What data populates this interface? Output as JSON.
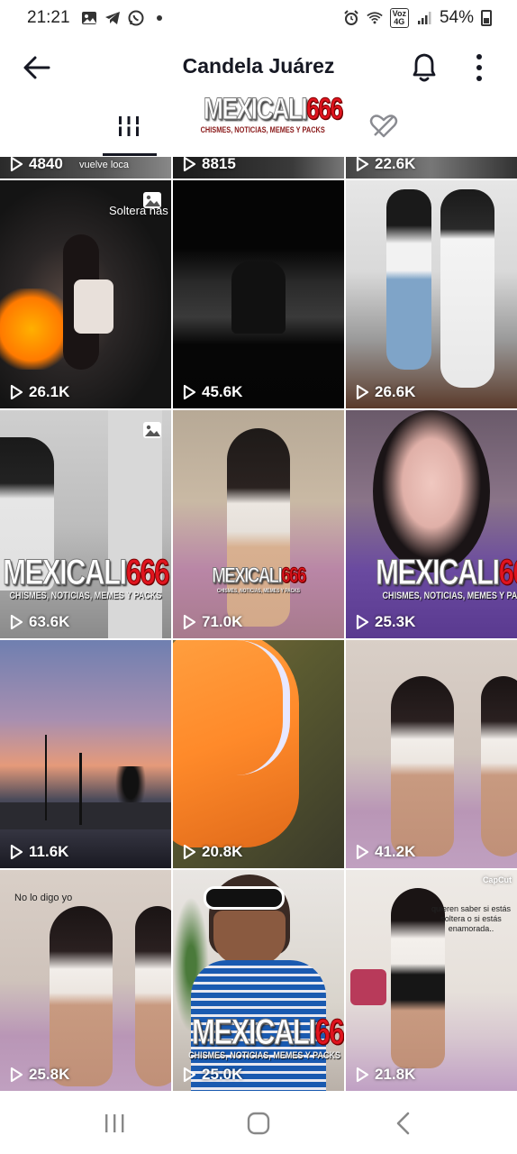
{
  "status_bar": {
    "time": "21:21",
    "notification_icons": [
      "gallery-icon",
      "telegram-icon",
      "whatsapp-icon"
    ],
    "network_badge_top": "Voz",
    "network_badge_bottom": "4G",
    "battery": "54%"
  },
  "header": {
    "title": "Candela Juárez"
  },
  "watermark": {
    "main": "MEXICALI",
    "number": "666",
    "subtitle": "CHISMES, NOTICIAS, MEMES Y PACKS"
  },
  "tabs": [
    {
      "name": "videos",
      "icon": "grid-lines-icon",
      "active": true
    },
    {
      "name": "liked",
      "icon": "hidden-heart-icon",
      "active": false
    }
  ],
  "videos": [
    {
      "views": "4840",
      "overlay": "vuelve loca"
    },
    {
      "views": "8815"
    },
    {
      "views": "22.6K"
    },
    {
      "views": "26.1K",
      "overlay": "Soltera has",
      "photo": true
    },
    {
      "views": "45.6K"
    },
    {
      "views": "26.6K"
    },
    {
      "views": "63.6K",
      "photo": true,
      "watermark": true
    },
    {
      "views": "71.0K",
      "watermark_small": true
    },
    {
      "views": "25.3K",
      "watermark": true
    },
    {
      "views": "11.6K"
    },
    {
      "views": "20.8K"
    },
    {
      "views": "41.2K"
    },
    {
      "views": "25.8K",
      "overlay": "No lo digo yo"
    },
    {
      "views": "25.0K",
      "watermark": true
    },
    {
      "views": "21.8K",
      "overlay": "quieren saber si estás soltera o si estás enamorada..",
      "brand": "CapCut"
    }
  ],
  "colors": {
    "text_primary": "#161823",
    "watermark_red": "#e0141e",
    "background": "#ffffff"
  },
  "navbar": {
    "buttons": [
      "recent-apps-icon",
      "home-icon",
      "back-nav-icon"
    ]
  }
}
